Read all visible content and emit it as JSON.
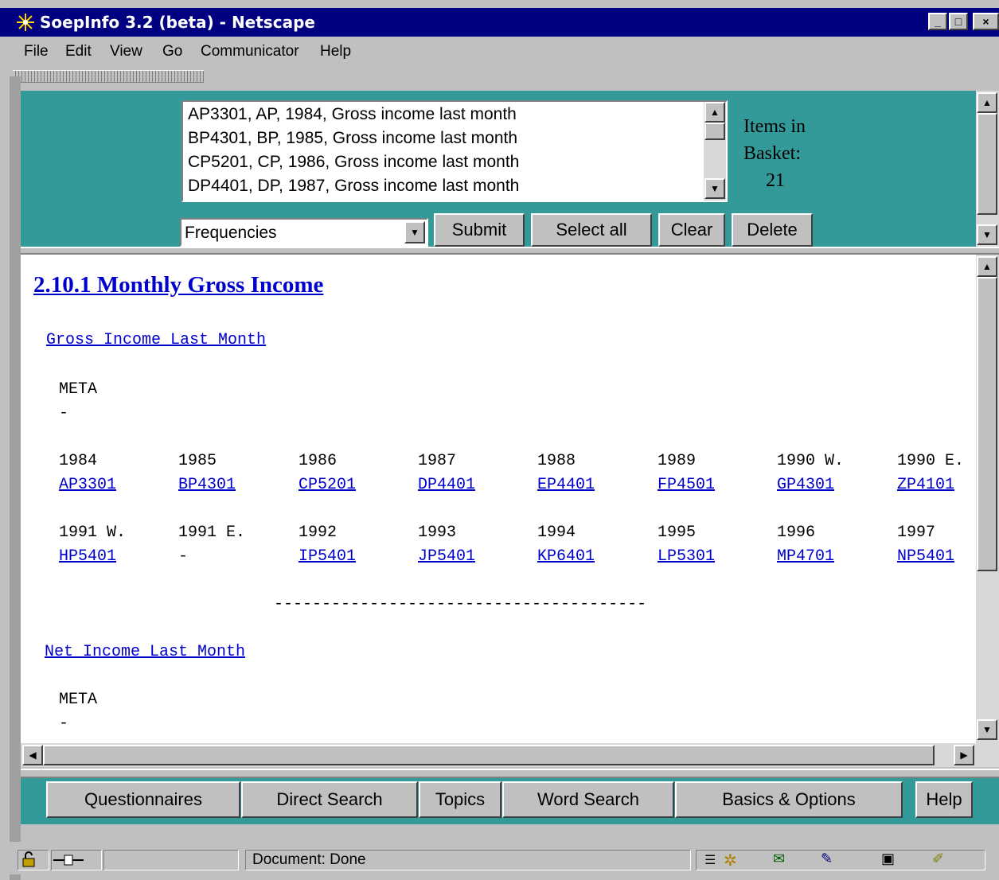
{
  "window": {
    "title": "SoepInfo 3.2 (beta) - Netscape",
    "controls": [
      "_",
      "□",
      "×"
    ]
  },
  "menu": [
    {
      "label": "File"
    },
    {
      "label": "Edit"
    },
    {
      "label": "View"
    },
    {
      "label": "Go"
    },
    {
      "label": "Communicator"
    },
    {
      "label": "Help"
    }
  ],
  "basket_list": {
    "items": [
      "AP3301, AP, 1984, Gross income last month",
      "BP4301, BP, 1985, Gross income last month",
      "CP5201, CP, 1986, Gross income last month",
      "DP4401, DP, 1987, Gross income last month"
    ]
  },
  "basket": {
    "label_line1": "Items in",
    "label_line2": "Basket:",
    "count": "21"
  },
  "controls": {
    "select_value": "Frequencies",
    "submit": "Submit",
    "select_all": "Select all",
    "clear": "Clear",
    "delete": "Delete"
  },
  "content": {
    "heading": "2.10.1 Monthly Gross Income",
    "section1": {
      "title": "Gross Income Last Month",
      "meta": "META",
      "meta_value": "-",
      "row1": [
        {
          "year": "1984",
          "var": "AP3301"
        },
        {
          "year": "1985",
          "var": "BP4301"
        },
        {
          "year": "1986",
          "var": "CP5201"
        },
        {
          "year": "1987",
          "var": "DP4401"
        },
        {
          "year": "1988",
          "var": "EP4401"
        },
        {
          "year": "1989",
          "var": "FP4501"
        },
        {
          "year": "1990 W.",
          "var": "GP4301"
        },
        {
          "year": "1990 E.",
          "var": "ZP4101"
        }
      ],
      "row2": [
        {
          "year": "1991 W.",
          "var": "HP5401"
        },
        {
          "year": "1991 E.",
          "var": "-"
        },
        {
          "year": "1992",
          "var": "IP5401"
        },
        {
          "year": "1993",
          "var": "JP5401"
        },
        {
          "year": "1994",
          "var": "KP6401"
        },
        {
          "year": "1995",
          "var": "LP5301"
        },
        {
          "year": "1996",
          "var": "MP4701"
        },
        {
          "year": "1997",
          "var": "NP5401"
        }
      ],
      "separator": "---------------------------------------"
    },
    "section2": {
      "title": "Net Income Last Month",
      "meta": "META",
      "meta_value": "-"
    }
  },
  "nav": {
    "questionnaires": "Questionnaires",
    "direct_search": "Direct Search",
    "topics": "Topics",
    "word_search": "Word Search",
    "basics_options": "Basics & Options",
    "help": "Help"
  },
  "status": {
    "text": "Document: Done"
  },
  "colors": {
    "title_bar": "#000080",
    "frame_teal": "#339999",
    "link": "#0000cc"
  }
}
